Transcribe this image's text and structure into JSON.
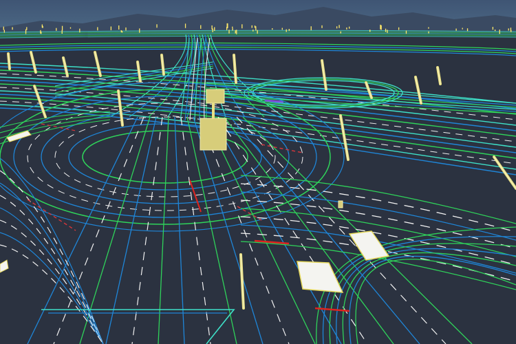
{
  "scene": {
    "kind": "hd-map-3d-viewer",
    "colors": {
      "sky_top": "#3f5574",
      "sky_bottom": "#4d6a86",
      "mountains": "#3a4a62",
      "ground": "#2b3240",
      "lane_boundary": "#1f86d8",
      "lane_divider": "#f2f2f2",
      "road_edge": "#2fd35a",
      "highway_glow": "#3ee0c8",
      "stop_line": "#e0241f",
      "crosswalk_fill": "#f4f4f0",
      "crosswalk_edge": "#e6d95c",
      "pole": "#e8df84",
      "sign_box": "#d7cd7a",
      "distant_markers": "#ffe96a",
      "dashed_red": "#d8363a",
      "purple_marker": "#7d4fd6"
    }
  }
}
